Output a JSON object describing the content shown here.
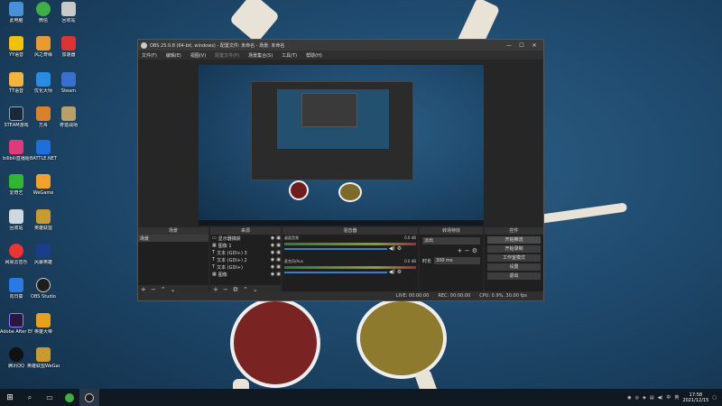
{
  "desktop": {
    "icons": [
      {
        "label": "此电脑"
      },
      {
        "label": "微信"
      },
      {
        "label": "回收站"
      },
      {
        "label": "YY语音"
      },
      {
        "label": "风之奇缘"
      },
      {
        "label": "加速器"
      },
      {
        "label": "TT语音"
      },
      {
        "label": "优化大师"
      },
      {
        "label": "Steam"
      },
      {
        "label": "STEAM游戏"
      },
      {
        "label": "方舟"
      },
      {
        "label": "奇迹战场"
      },
      {
        "label": "bilibili直播姬"
      },
      {
        "label": "BATTLE.NET"
      },
      {
        "label": "爱奇艺"
      },
      {
        "label": "WeGame"
      },
      {
        "label": "回收站"
      },
      {
        "label": "英雄联盟"
      },
      {
        "label": "网易云音乐"
      },
      {
        "label": "风暴英雄"
      },
      {
        "label": "向日葵"
      },
      {
        "label": "OBS Studio"
      },
      {
        "label": "Adobe After Effects CC"
      },
      {
        "label": "英雄大帝"
      },
      {
        "label": "腾讯QQ"
      },
      {
        "label": "英雄联盟WeGame版"
      }
    ]
  },
  "obs": {
    "title": "OBS 25.0.8 (64-bit, windows) - 配置文件: 未命名 - 场景: 未命名",
    "window_buttons": {
      "min": "—",
      "max": "☐",
      "close": "✕"
    },
    "menu": [
      "文件(F)",
      "编辑(E)",
      "视图(V)",
      "配置文件(P)",
      "场景集合(S)",
      "工具(T)",
      "帮助(H)"
    ],
    "docks": {
      "scenes": {
        "title": "场景",
        "items": [
          "场景"
        ]
      },
      "sources": {
        "title": "来源",
        "items": [
          "显示器捕获",
          "图像 1",
          "文本 (GDI+) 3",
          "文本 (GDI+) 2",
          "文本 (GDI+)",
          "图像"
        ]
      },
      "mixer": {
        "title": "混音器",
        "channels": [
          {
            "name": "桌面音频",
            "db": "0.0 dB"
          },
          {
            "name": "麦克风/Aux",
            "db": "0.0 dB"
          }
        ]
      },
      "transitions": {
        "title": "转场特效",
        "selected": "淡出",
        "duration_label": "时长",
        "duration_value": "300 ms"
      },
      "controls": {
        "title": "控件",
        "buttons": [
          "开始推流",
          "开始录制",
          "工作室模式",
          "设置",
          "退出"
        ]
      }
    },
    "status": {
      "live": "LIVE: 00:00:00",
      "rec": "REC: 00:00:00",
      "cpu": "CPU: 0.9%, 30.00 fps"
    }
  },
  "taskbar": {
    "tray_time": "17:58",
    "tray_date": "2021/12/15",
    "ime": "中",
    "volume": "英"
  }
}
